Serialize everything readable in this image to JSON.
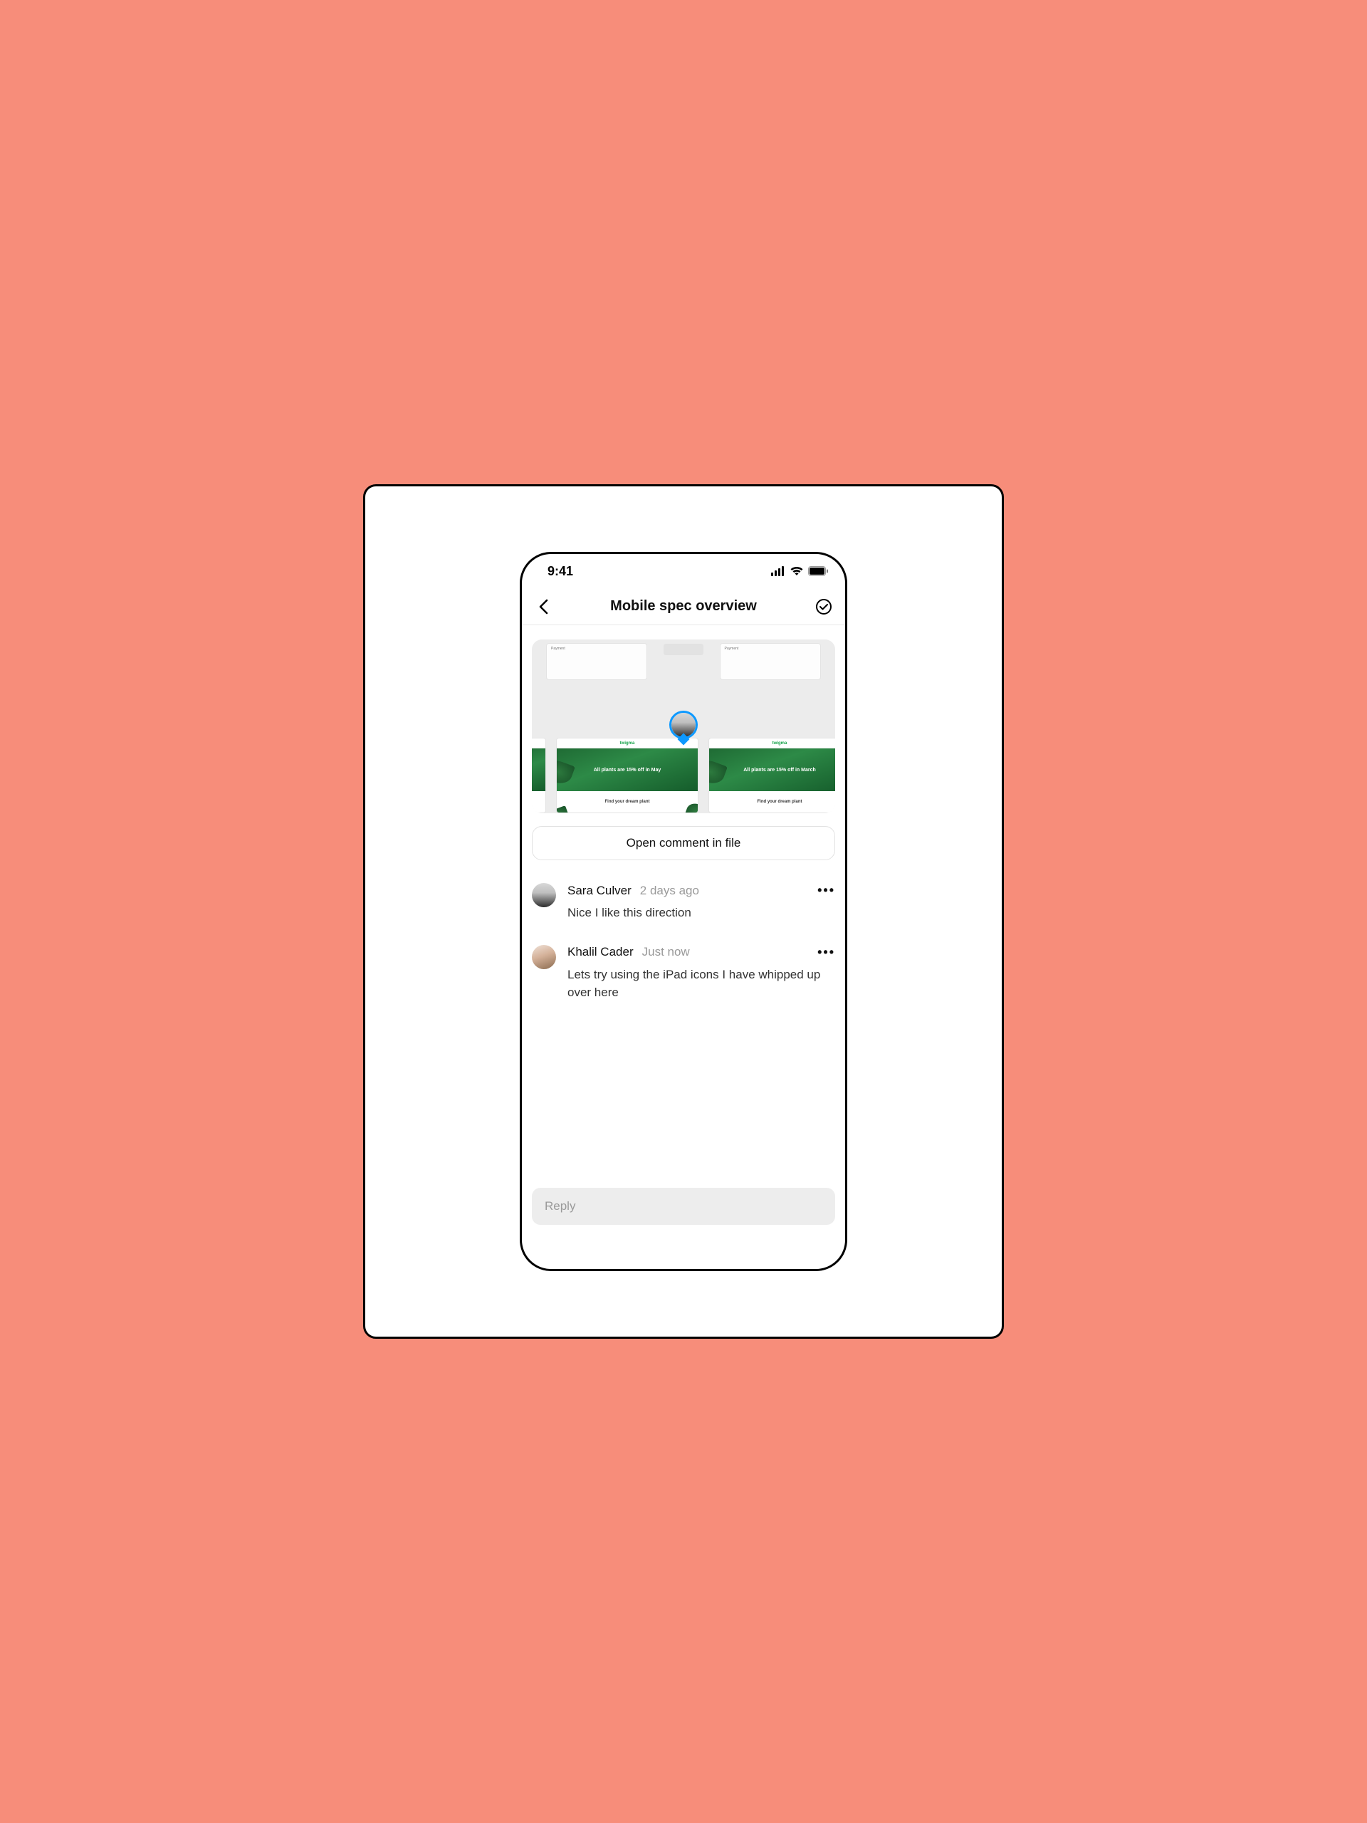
{
  "statusbar": {
    "time": "9:41"
  },
  "nav": {
    "title": "Mobile spec overview"
  },
  "preview": {
    "brand": "twigma",
    "hero1": "All plants are 15% off in May",
    "hero2": "All plants are 15% off in March",
    "tagline": "Find your dream plant",
    "card_label": "Payment"
  },
  "open_button": "Open comment in file",
  "comments": [
    {
      "author": "Sara Culver",
      "time": "2 days ago",
      "text": "Nice I like this direction"
    },
    {
      "author": "Khalil Cader",
      "time": "Just now",
      "text": "Lets try using the iPad icons I have whipped up over here"
    }
  ],
  "reply": {
    "placeholder": "Reply"
  }
}
